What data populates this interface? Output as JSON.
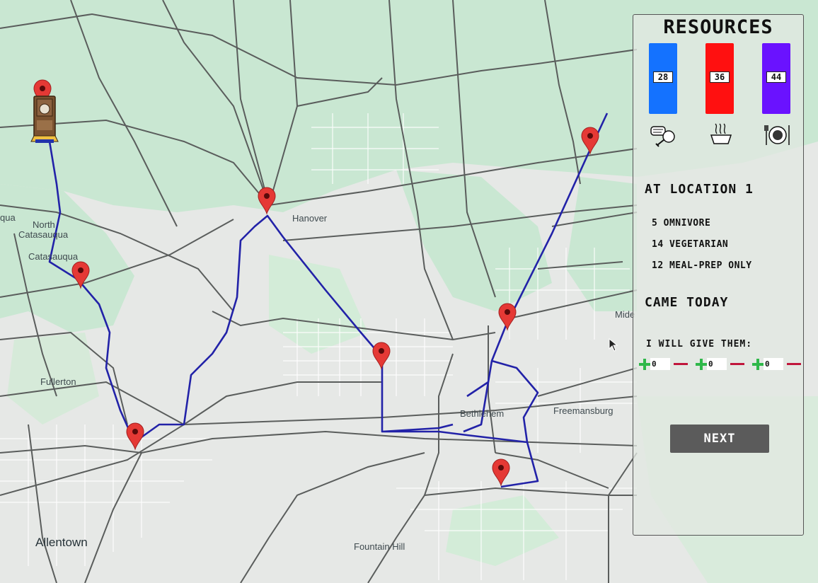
{
  "map": {
    "places": [
      "North\nCatasauqua",
      "Catasauqua",
      "Hanover",
      "Fullerton",
      "Bethlehem",
      "Freemansburg",
      "Allentown",
      "Fountain Hill",
      "Mide",
      "qua"
    ],
    "pin_count": 9,
    "route_color": "#2222a8",
    "pin_color": "#e53935"
  },
  "panel": {
    "title": "RESOURCES",
    "resources": [
      {
        "name": "omnivore-food",
        "value": "28",
        "color": "#1472ff",
        "icon": "meat-icon"
      },
      {
        "name": "vegetarian-food",
        "value": "36",
        "color": "#ff1010",
        "icon": "noodles-icon"
      },
      {
        "name": "meal-prep",
        "value": "44",
        "color": "#6a12ff",
        "icon": "plate-icon"
      }
    ],
    "location_heading": "AT LOCATION 1",
    "counts": [
      "5 OMNIVORE",
      "14 VEGETARIAN",
      "12 MEAL-PREP ONLY"
    ],
    "came_today": "CAME TODAY",
    "give_label": "I WILL GIVE THEM:",
    "give_values": [
      "0",
      "0",
      "0"
    ],
    "next_label": "NEXT"
  }
}
